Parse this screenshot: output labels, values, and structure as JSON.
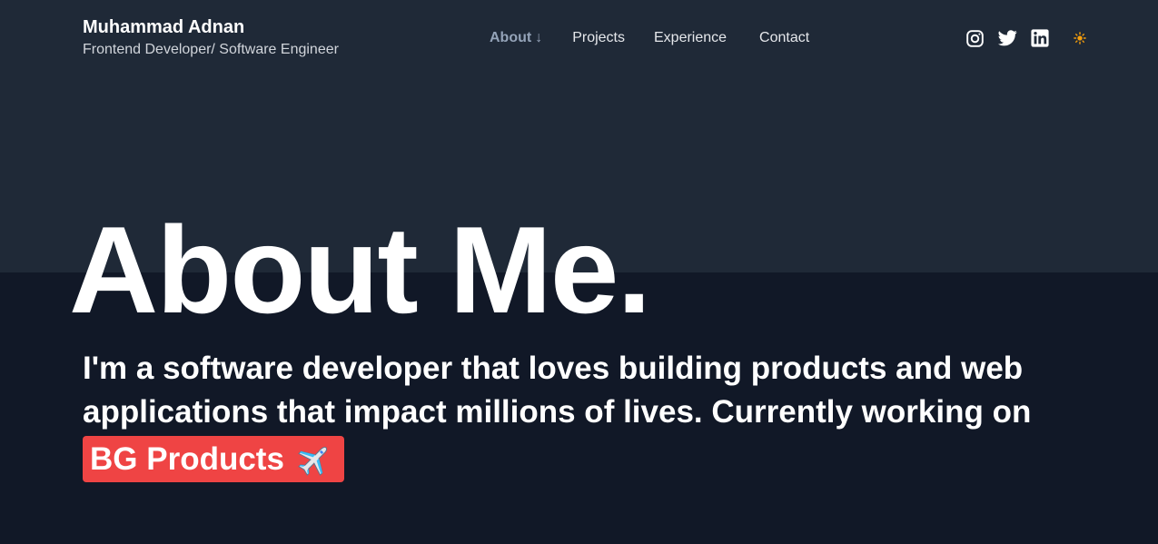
{
  "header": {
    "name": "Muhammad Adnan",
    "role": "Frontend Developer/ Software Engineer"
  },
  "nav": {
    "items": [
      {
        "label": "About",
        "suffix": "↓",
        "active": true
      },
      {
        "label": "Projects"
      },
      {
        "label": "Experience"
      },
      {
        "label": "Contact"
      }
    ]
  },
  "socials": {
    "icons": [
      "instagram-icon",
      "twitter-icon",
      "linkedin-icon",
      "sun-icon"
    ]
  },
  "hero": {
    "title": "About Me.",
    "line1": "I'm a software developer that loves building products and web",
    "line2": "applications that impact millions of lives. Currently working on",
    "company": "BG Products"
  },
  "colors": {
    "top_background": "#1f2937",
    "bottom_background": "#111827",
    "badge": "#ef4444",
    "sun": "#f59e0b",
    "active_nav": "#94a3b8"
  }
}
